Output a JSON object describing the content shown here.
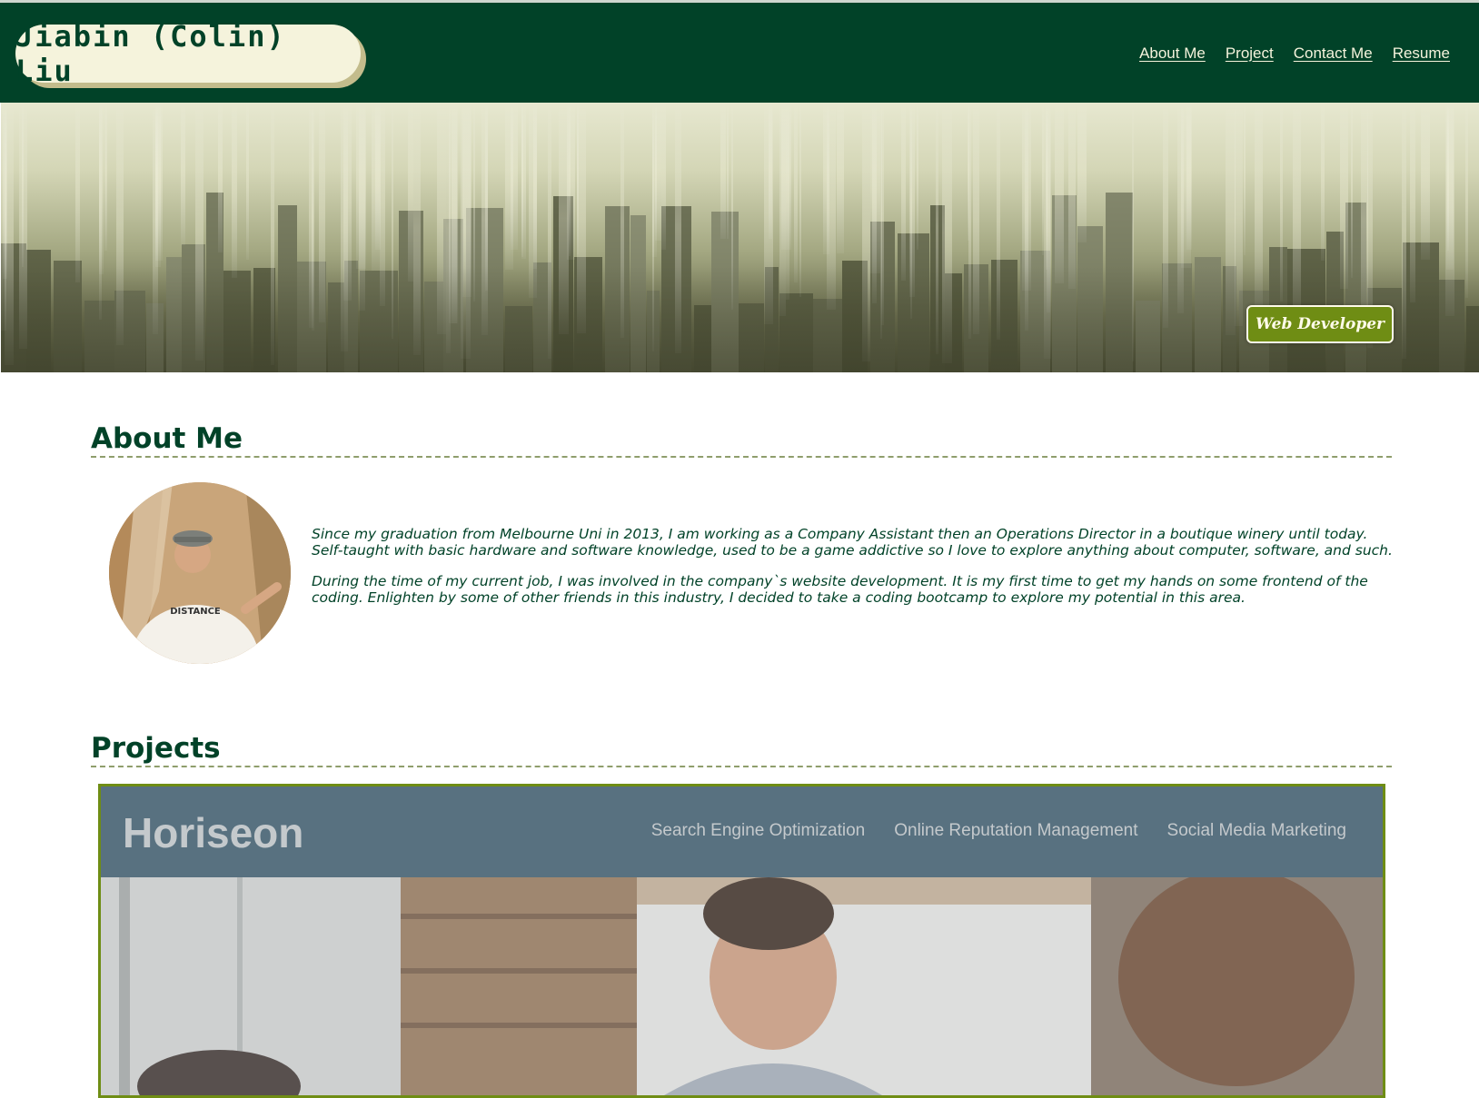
{
  "site": {
    "name": "Jiabin (Colin) Liu"
  },
  "nav": [
    {
      "label": "About Me"
    },
    {
      "label": "Project"
    },
    {
      "label": "Contact Me"
    },
    {
      "label": "Resume"
    }
  ],
  "hero": {
    "badge": "Web Developer"
  },
  "about": {
    "title": "About Me",
    "paragraphs": [
      "Since my graduation from Melbourne Uni in 2013, I am working as a Company Assistant then an Operations Director in a boutique winery until today. Self-taught with basic hardware and software knowledge, used to be a game addictive so I love to explore anything about computer, software, and such.",
      "During the time of my current job, I was involved in the company`s website development. It is my first time to get my hands on some frontend of the coding. Enlighten by some of other friends in this industry, I decided to take a coding bootcamp to explore my potential in this area."
    ]
  },
  "projects": {
    "title": "Projects",
    "card": {
      "logo": "Horiseon",
      "nav": [
        "Search Engine Optimization",
        "Online Reputation Management",
        "Social Media Marketing"
      ]
    }
  },
  "colors": {
    "header_bg": "#014228",
    "accent": "#6f8d14",
    "cream": "#f5f3dc"
  }
}
